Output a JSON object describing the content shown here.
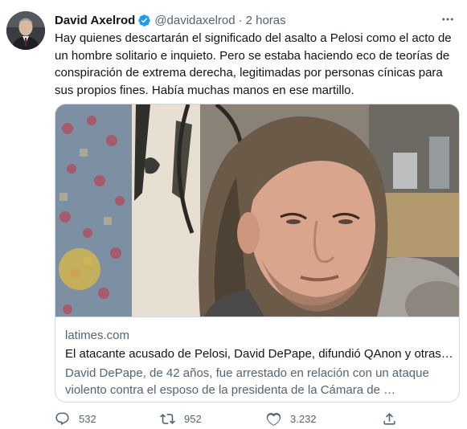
{
  "tweet": {
    "author": {
      "display_name": "David Axelrod",
      "handle": "@davidaxelrod",
      "separator": "·",
      "time": "2 horas"
    },
    "text_lines": [
      "Hay quienes descartarán el significado del asalto a Pelosi como el acto de",
      "un hombre solitario e inquieto. Pero se estaba haciendo eco de teorías de",
      "conspiración de extrema derecha, legitimadas por personas cínicas para",
      "sus propios fines. Había muchas manos en ese martillo."
    ],
    "card": {
      "domain": "latimes.com",
      "title": "El atacante acusado de Pelosi, David DePape, difundió QAnon y otras…",
      "description_lines": [
        "David DePape, de 42 años, fue arrestado en relación con un ataque",
        "violento contra el esposo de la presidenta de la Cámara de …"
      ]
    },
    "actions": {
      "replies": "532",
      "retweets": "952",
      "likes": "3.232"
    },
    "colors": {
      "text": "#0f1419",
      "secondary": "#536471",
      "verified": "#1d9bf0",
      "border": "#cfd9de"
    }
  }
}
